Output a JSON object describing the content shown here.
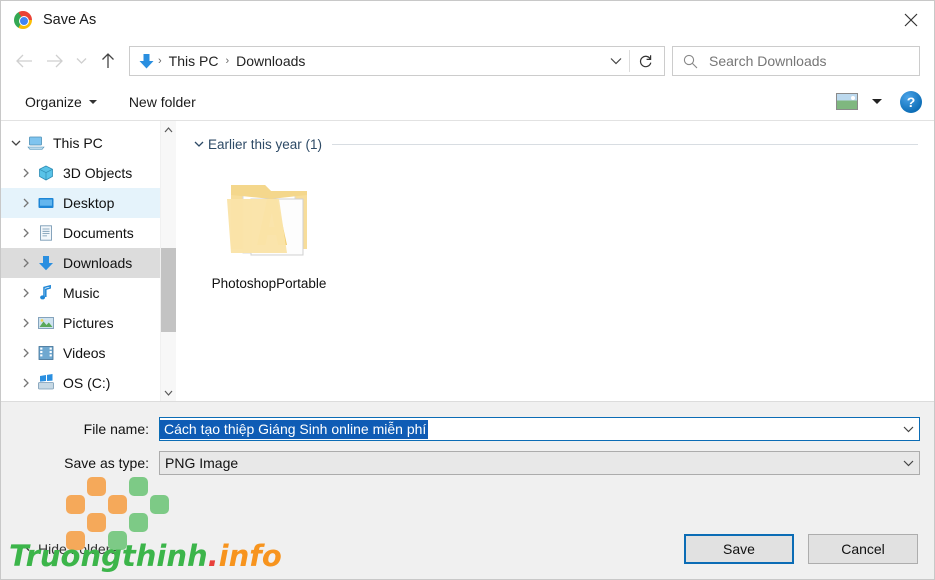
{
  "window": {
    "title": "Save As",
    "app_icon": "chrome-icon",
    "close_label": "✕"
  },
  "nav": {
    "back_label": "←",
    "forward_label": "→",
    "history_label": "⌄",
    "up_label": "↑",
    "breadcrumb": [
      {
        "label": "This PC"
      },
      {
        "label": "Downloads"
      }
    ],
    "breadcrumb_icon": "downloads-arrow-icon",
    "separator": "›",
    "address_chevron": "⌄",
    "refresh_label": "↻",
    "search_placeholder": "Search Downloads",
    "search_icon": "search-icon"
  },
  "toolbar": {
    "organize_label": "Organize",
    "new_folder_label": "New folder",
    "view_icon": "picture-view-icon",
    "view_caret": "▾",
    "help_label": "?"
  },
  "sidebar": {
    "items": [
      {
        "label": "This PC",
        "icon": "pc-icon",
        "expander": "⌄",
        "state": "expanded",
        "indent": 0
      },
      {
        "label": "3D Objects",
        "icon": "cube-icon",
        "expander": "›",
        "state": "normal",
        "indent": 1
      },
      {
        "label": "Desktop",
        "icon": "desktop-icon",
        "expander": "›",
        "state": "hover",
        "indent": 1
      },
      {
        "label": "Documents",
        "icon": "documents-icon",
        "expander": "›",
        "state": "normal",
        "indent": 1
      },
      {
        "label": "Downloads",
        "icon": "downloads-icon",
        "expander": "›",
        "state": "active",
        "indent": 1
      },
      {
        "label": "Music",
        "icon": "music-icon",
        "expander": "›",
        "state": "normal",
        "indent": 1
      },
      {
        "label": "Pictures",
        "icon": "pictures-icon",
        "expander": "›",
        "state": "normal",
        "indent": 1
      },
      {
        "label": "Videos",
        "icon": "videos-icon",
        "expander": "›",
        "state": "normal",
        "indent": 1
      },
      {
        "label": "OS (C:)",
        "icon": "drive-icon",
        "expander": "›",
        "state": "normal",
        "indent": 1
      }
    ],
    "scroll_up": "⌃",
    "scroll_down": "⌄"
  },
  "content": {
    "group_header": "Earlier this year (1)",
    "group_chevron": "⌄",
    "files": [
      {
        "name": "PhotoshopPortable",
        "icon": "folder-open-icon"
      }
    ]
  },
  "form": {
    "file_name_label": "File name:",
    "file_name_value": "Cách tạo thiệp Giáng Sinh online miễn phí",
    "save_type_label": "Save as type:",
    "save_type_value": "PNG Image",
    "dropdown_caret": "⌄"
  },
  "footer": {
    "hide_folders_label": "Hide Folders",
    "hide_folders_chevron": "⌃",
    "save_label": "Save",
    "cancel_label": "Cancel"
  },
  "watermark": {
    "text_main": "Truongthinh",
    "text_dot": ".",
    "text_suffix": "info",
    "color_green": "#3cb54a",
    "color_orange": "#f7941e",
    "color_red": "#e8403a"
  },
  "colors": {
    "accent": "#0b6cb5",
    "selection": "#0f5cb5",
    "chrome_surface": "#f0f0f0",
    "tree_selected": "#dcdcdc",
    "tree_hover": "#e5f3fb"
  }
}
